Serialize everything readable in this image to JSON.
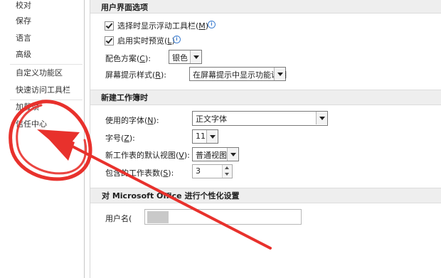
{
  "sidebar": {
    "items": [
      {
        "label": "校对"
      },
      {
        "label": "保存"
      },
      {
        "label": "语言"
      },
      {
        "label": "高级"
      },
      {
        "label": "自定义功能区"
      },
      {
        "label": "快速访问工具栏"
      },
      {
        "label": "加载项"
      },
      {
        "label": "信任中心"
      }
    ]
  },
  "ui_section": {
    "title": "用户界面选项",
    "show_mini_toolbar": {
      "pre": "选择时显示浮动工具栏(",
      "key": "M",
      "post": ")",
      "checked": true
    },
    "live_preview": {
      "pre": "启用实时预览(",
      "key": "L",
      "post": ")",
      "checked": true
    },
    "color_scheme": {
      "pre": "配色方案(",
      "key": "C",
      "post": "):",
      "value": "银色"
    },
    "screentip": {
      "pre": "屏幕提示样式(",
      "key": "R",
      "post": "):",
      "value": "在屏幕提示中显示功能说明"
    }
  },
  "new_workbook": {
    "title": "新建工作簿时",
    "font": {
      "pre": "使用的字体(",
      "key": "N",
      "post": "):",
      "value": "正文字体"
    },
    "font_size": {
      "pre": "字号(",
      "key": "Z",
      "post": "):",
      "value": "11"
    },
    "default_view": {
      "pre": "新工作表的默认视图(",
      "key": "V",
      "post": "):",
      "value": "普通视图"
    },
    "sheet_count": {
      "pre": "包含的工作表数(",
      "key": "S",
      "post": "):",
      "value": "3"
    }
  },
  "personalize": {
    "title": "对 Microsoft Office 进行个性化设置",
    "username_label": "用户名("
  },
  "annotation": {
    "color": "#e8312c"
  }
}
